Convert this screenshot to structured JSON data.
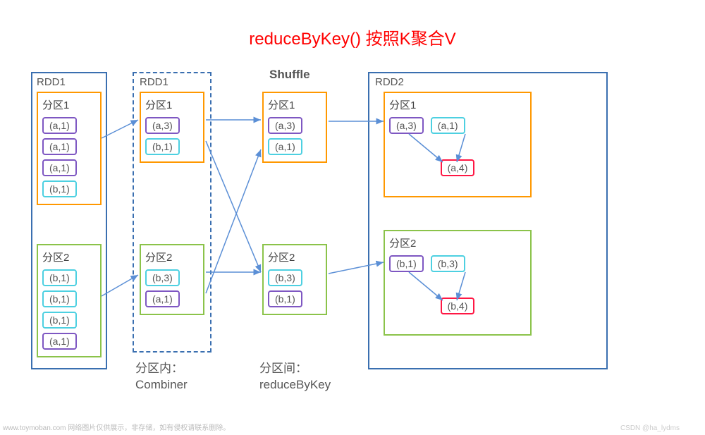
{
  "title": "reduceByKey() 按照K聚合V",
  "labels": {
    "rdd1_left": "RDD1",
    "rdd1_mid": "RDD1",
    "shuffle": "Shuffle",
    "rdd2": "RDD2",
    "combiner_cn": "分区内：",
    "combiner_en": "Combiner",
    "reduce_cn": "分区间：",
    "reduce_en": "reduceByKey"
  },
  "partitions": {
    "left_p1": {
      "label": "分区1",
      "tuples": [
        "(a,1)",
        "(a,1)",
        "(a,1)",
        "(b,1)"
      ]
    },
    "left_p2": {
      "label": "分区2",
      "tuples": [
        "(b,1)",
        "(b,1)",
        "(b,1)",
        "(a,1)"
      ]
    },
    "mid_p1": {
      "label": "分区1",
      "tuples": [
        "(a,3)",
        "(b,1)"
      ]
    },
    "mid_p2": {
      "label": "分区2",
      "tuples": [
        "(b,3)",
        "(a,1)"
      ]
    },
    "shuf_p1": {
      "label": "分区1",
      "tuples": [
        "(a,3)",
        "(a,1)"
      ]
    },
    "shuf_p2": {
      "label": "分区2",
      "tuples": [
        "(b,3)",
        "(b,1)"
      ]
    },
    "right_p1": {
      "label": "分区1",
      "row": [
        "(a,3)",
        "(a,1)"
      ],
      "result": "(a,4)"
    },
    "right_p2": {
      "label": "分区2",
      "row": [
        "(b,1)",
        "(b,3)"
      ],
      "result": "(b,4)"
    }
  },
  "watermark": "www.toymoban.com 网络图片仅供展示，非存储，如有侵权请联系删除。",
  "watermark_r": "CSDN @ha_lydms"
}
